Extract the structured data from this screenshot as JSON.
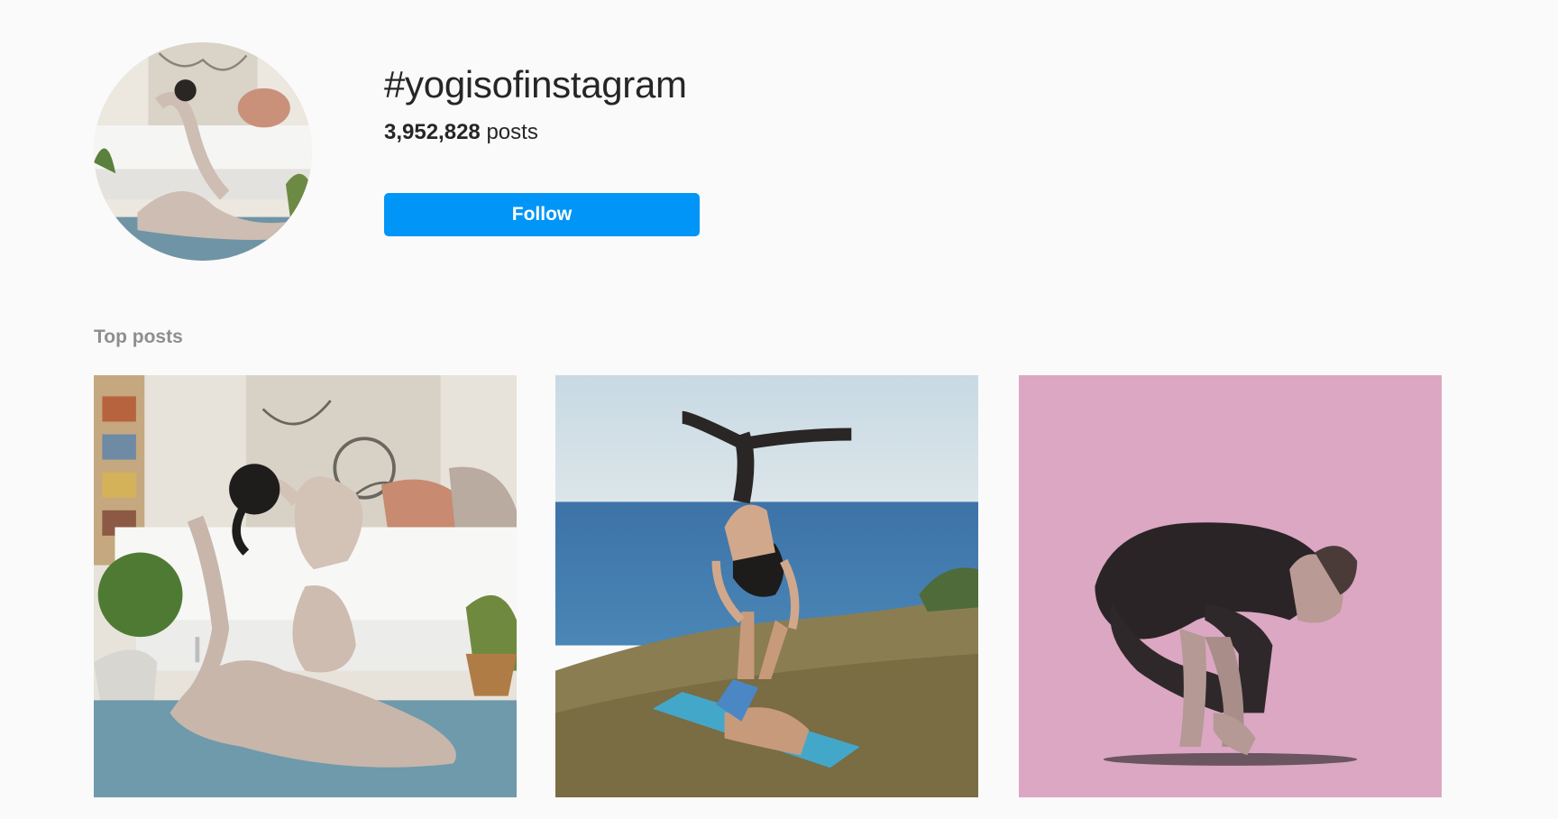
{
  "hashtag": {
    "title": "#yogisofinstagram",
    "post_count": "3,952,828",
    "post_count_suffix": "posts",
    "follow_label": "Follow"
  },
  "sections": {
    "top_posts_label": "Top posts"
  },
  "top_posts": [
    {
      "kind": "photo",
      "subject": "woman in pigeon pose in bedroom"
    },
    {
      "kind": "photo",
      "subject": "acro yoga by the sea"
    },
    {
      "kind": "photo",
      "subject": "man in crow pose on pink background"
    }
  ],
  "colors": {
    "background": "#fafafa",
    "button": "#0095f6",
    "button_text": "#ffffff",
    "muted_text": "#8e8e8e",
    "primary_text": "#262626"
  }
}
